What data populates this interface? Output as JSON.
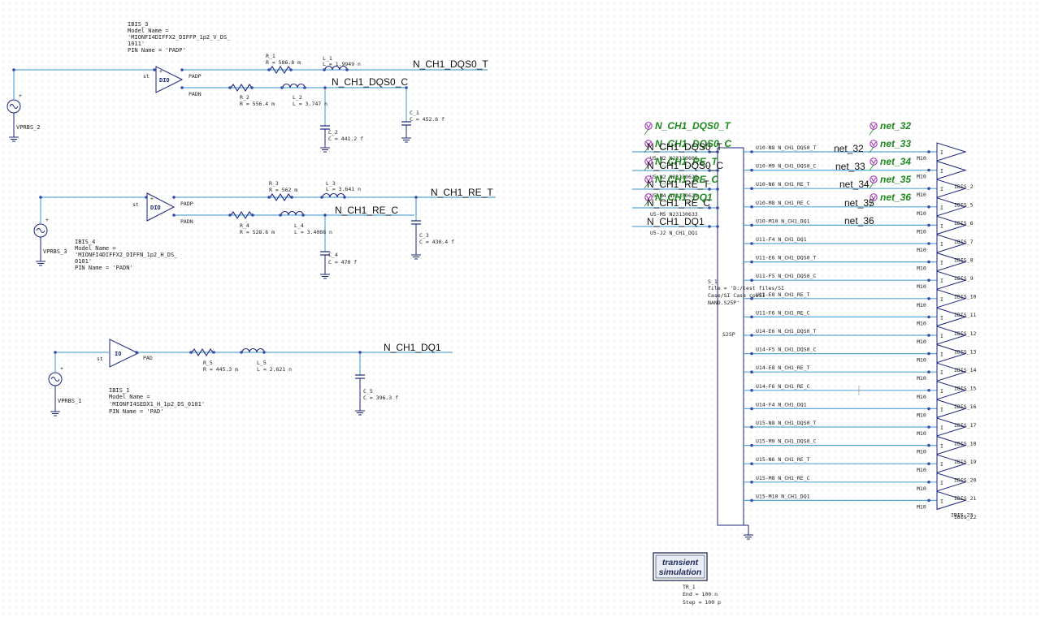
{
  "colors": {
    "wire": "#5aa8d6",
    "comp": "#1a237e",
    "dot": "#3949ab",
    "tag": "#1f8a1f",
    "tagmark": "#9c27b0",
    "pin": "#c62828",
    "text": "#202020"
  },
  "ibis3": {
    "lines": [
      "IBIS_3",
      "Model Name =",
      "'MIONFI4DIFFX2_DIFFP_1p2_V_DS_",
      "1011'",
      "PIN Name = 'PADP'"
    ],
    "st": "st",
    "sym": "DIO",
    "padp": "PADP",
    "padn": "PADN"
  },
  "ibis4": {
    "lines": [
      "IBIS_4",
      "Model Name =",
      "'MIONFI4DIFFX2_DIFFN_1p2_H_DS_",
      "0101'",
      "PIN Name = 'PADN'"
    ],
    "st": "st",
    "sym": "DIO",
    "padp": "PADP",
    "padn": "PADN"
  },
  "ibis1": {
    "lines": [
      "IBIS_1",
      "Model Name =",
      "'MIONFI4SEDX1_H_1p2_DS_0101'",
      "PIN Name = 'PAD'"
    ],
    "st": "st",
    "sym": "IO",
    "pad": "PAD"
  },
  "sources": {
    "v2": "VPRBS_2",
    "v3": "VPRBS_3",
    "v1": "VPRBS_1"
  },
  "c1": {
    "r1": [
      "R_1",
      "R = 586.8 m"
    ],
    "l1": [
      "L_1",
      "L = 1.9949 n"
    ],
    "r2": [
      "R_2",
      "R = 556.4 m"
    ],
    "l2": [
      "L_2",
      "L = 3.747 n"
    ],
    "c1": [
      "C_1",
      "C = 452.6 f"
    ],
    "c2": [
      "C_2",
      "C = 441.2 f"
    ],
    "netT": "N_CH1_DQS0_T",
    "netC": "N_CH1_DQS0_C"
  },
  "c2": {
    "r3": [
      "R_3",
      "R = 562 m"
    ],
    "l3": [
      "L_3",
      "L = 3.641 n"
    ],
    "r4": [
      "R_4",
      "R = 528.6 m"
    ],
    "l4": [
      "L_4",
      "L = 3.4088 n"
    ],
    "c3": [
      "C_3",
      "C = 430.4 f"
    ],
    "c4": [
      "C_4",
      "C = 470 f"
    ],
    "netT": "N_CH1_RE_T",
    "netC": "N_CH1_RE_C"
  },
  "c3": {
    "r5": [
      "R_5",
      "R = 445.3 m"
    ],
    "l5": [
      "L_5",
      "L = 2.621 n"
    ],
    "c5": [
      "C_5",
      "C = 396.3 f"
    ],
    "net": "N_CH1_DQ1"
  },
  "tags_left": [
    "N_CH1_DQS0_T",
    "N_CH1_DQS0_C",
    "N_CH1_RE_T",
    "N_CH1_RE_C",
    "N_CH1_DQ1"
  ],
  "overlay_net_left": [
    "N_CH1_DQS0_T",
    "N_CH1_DQS0_C",
    "N_CH1_RE_T",
    "N_CH1_RE_C",
    "N_CH1_DQ1"
  ],
  "left_pins": [
    "U5-M2 N23130606",
    "U5-N2 N23130628",
    "U5-M4 N23130629",
    "U5-M5 N23130633",
    "U5-J2 N_CH1_DQ1"
  ],
  "tags_right": [
    "net_32",
    "net_33",
    "net_34",
    "net_35",
    "net_36"
  ],
  "overlay_net_right": [
    "net_32",
    "net_33",
    "net_34",
    "net_35",
    "net_36"
  ],
  "right_pins": [
    "U10-N8 N_CH1_DQS0_T",
    "U10-M9 N_CH1_DQS0_C",
    "U10-N6 N_CH1_RE_T",
    "U10-M8 N_CH1_RE_C",
    "U10-M10 N_CH1_DQ1",
    "U11-F4 N_CH1_DQ1",
    "U11-E6 N_CH1_DQS0_T",
    "U11-F5 N_CH1_DQS0_C",
    "U11-E8 N_CH1_RE_T",
    "U11-F6 N_CH1_RE_C",
    "U14-E6 N_CH1_DQS0_T",
    "U14-F5 N_CH1_DQS0_C",
    "U14-E8 N_CH1_RE_T",
    "U14-F6 N_CH1_RE_C",
    "U14-F4 N_CH1_DQ1",
    "U15-N8 N_CH1_DQS0_T",
    "U15-M9 N_CH1_DQS0_C",
    "U15-N6 N_CH1_RE_T",
    "U15-M8 N_CH1_RE_C",
    "U15-M10 N_CH1_DQ1"
  ],
  "m10": "M10",
  "ibis_labels": [
    "IBIS_2",
    "IBIS_5",
    "IBIS_6",
    "IBIS_7",
    "IBIS_8",
    "IBIS_9",
    "IBIS_10",
    "IBIS_11",
    "IBIS_12",
    "IBIS_13",
    "IBIS_14",
    "IBIS_15",
    "IBIS_16",
    "IBIS_17",
    "IBIS_18",
    "IBIS_19",
    "IBIS_20",
    "IBIS_21",
    "IBIS_22",
    "IBIS_23"
  ],
  "sparam": {
    "lines": [
      "S_1",
      "file = 'D:/test files/SI",
      "Case/SI Case_cpeSI",
      "NAND.S25P'"
    ],
    "type": "S25P"
  },
  "tran": {
    "title1": "transient",
    "title2": "simulation",
    "lines": [
      "TR_1",
      "End = 100 n",
      "Step = 100 p"
    ]
  }
}
